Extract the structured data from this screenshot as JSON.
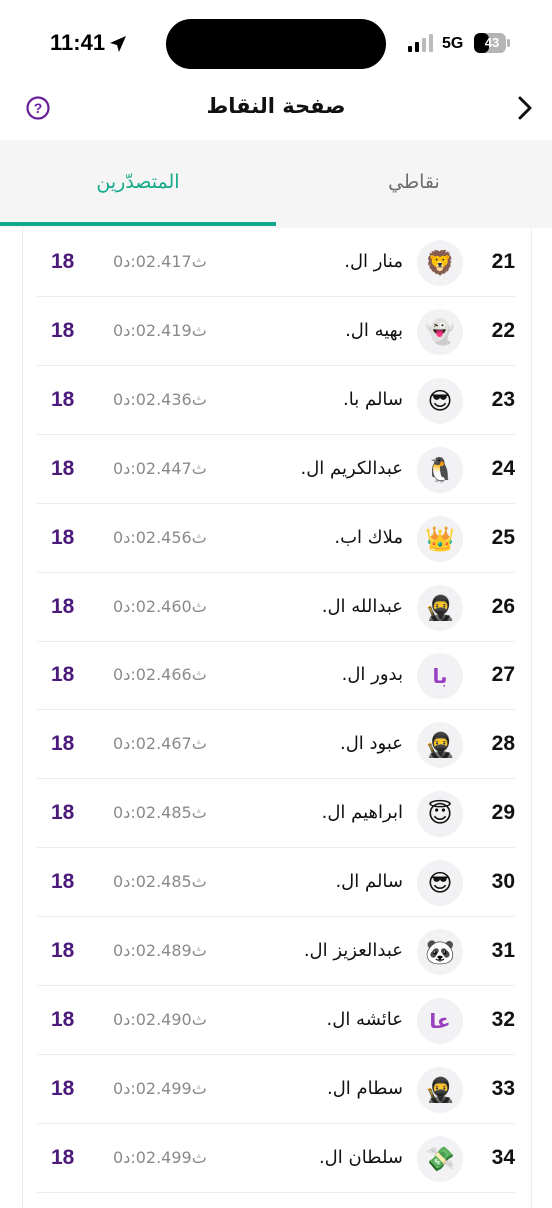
{
  "status_bar": {
    "time": "11:41",
    "network": "5G",
    "battery": "43"
  },
  "header": {
    "title": "صفحة النقاط",
    "help_icon": "question-circle-icon",
    "back_icon": "chevron-right-icon"
  },
  "tabs": [
    {
      "label": "المتصدّرين",
      "active": true
    },
    {
      "label": "نقاطي",
      "active": false
    }
  ],
  "colors": {
    "accent": "#13a889",
    "points": "#4b1a7a",
    "help": "#6a1f9a"
  },
  "leaderboard": [
    {
      "rank": "21",
      "avatar": "🦁",
      "avatar_name": "lion-avatar",
      "name": "منار ال.",
      "time": "ث02.417:د0",
      "points": "18"
    },
    {
      "rank": "22",
      "avatar": "👻",
      "avatar_name": "ghost-avatar",
      "name": "بهيه ال.",
      "time": "ث02.419:د0",
      "points": "18"
    },
    {
      "rank": "23",
      "avatar": "😎",
      "avatar_name": "sunglasses-avatar",
      "name": "سالم با.",
      "time": "ث02.436:د0",
      "points": "18"
    },
    {
      "rank": "24",
      "avatar": "🐧",
      "avatar_name": "penguin-avatar",
      "name": "عبدالكريم ال.",
      "time": "ث02.447:د0",
      "points": "18"
    },
    {
      "rank": "25",
      "avatar": "👑",
      "avatar_name": "crown-avatar",
      "name": "ملاك اب.",
      "time": "ث02.456:د0",
      "points": "18"
    },
    {
      "rank": "26",
      "avatar": "🥷",
      "avatar_name": "ninja-avatar",
      "name": "عبدالله ال.",
      "time": "ث02.460:د0",
      "points": "18"
    },
    {
      "rank": "27",
      "avatar": "با",
      "avatar_name": "initials-avatar",
      "name": "بدور ال.",
      "time": "ث02.466:د0",
      "points": "18"
    },
    {
      "rank": "28",
      "avatar": "🥷",
      "avatar_name": "ninja-avatar",
      "name": "عبود ال.",
      "time": "ث02.467:د0",
      "points": "18"
    },
    {
      "rank": "29",
      "avatar": "😇",
      "avatar_name": "halo-avatar",
      "name": "ابراهيم ال.",
      "time": "ث02.485:د0",
      "points": "18"
    },
    {
      "rank": "30",
      "avatar": "😎",
      "avatar_name": "sunglasses-avatar",
      "name": "سالم ال.",
      "time": "ث02.485:د0",
      "points": "18"
    },
    {
      "rank": "31",
      "avatar": "🐼",
      "avatar_name": "panda-avatar",
      "name": "عبدالعزيز ال.",
      "time": "ث02.489:د0",
      "points": "18"
    },
    {
      "rank": "32",
      "avatar": "عا",
      "avatar_name": "initials-avatar",
      "name": "عائشه ال.",
      "time": "ث02.490:د0",
      "points": "18"
    },
    {
      "rank": "33",
      "avatar": "🥷",
      "avatar_name": "ninja-avatar",
      "name": "سطام ال.",
      "time": "ث02.499:د0",
      "points": "18"
    },
    {
      "rank": "34",
      "avatar": "💸",
      "avatar_name": "money-avatar",
      "name": "سلطان ال.",
      "time": "ث02.499:د0",
      "points": "18"
    }
  ]
}
